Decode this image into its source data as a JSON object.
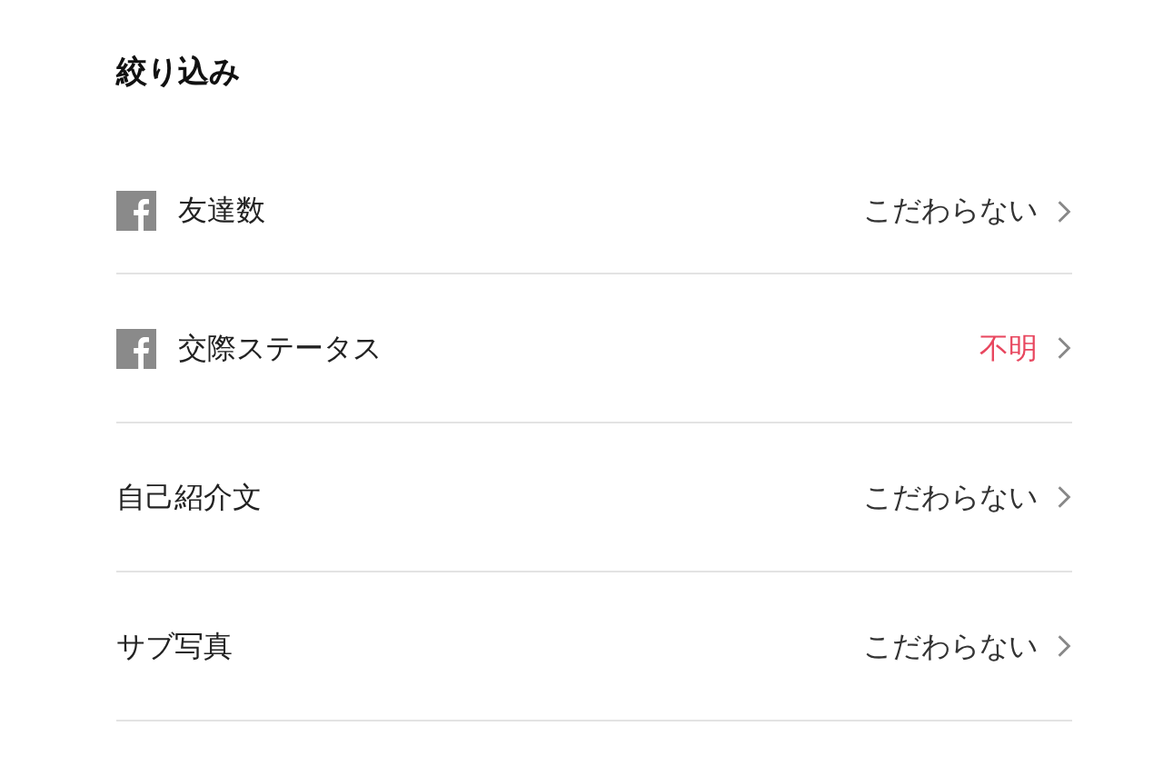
{
  "title": "絞り込み",
  "rows": [
    {
      "kind": "facebook",
      "label": "友達数",
      "value": "こだわらない",
      "alert": false
    },
    {
      "kind": "facebook",
      "label": "交際ステータス",
      "value": "不明",
      "alert": true
    },
    {
      "kind": "plain",
      "label": "自己紹介文",
      "value": "こだわらない",
      "alert": false
    },
    {
      "kind": "plain",
      "label": "サブ写真",
      "value": "こだわらない",
      "alert": false
    }
  ]
}
